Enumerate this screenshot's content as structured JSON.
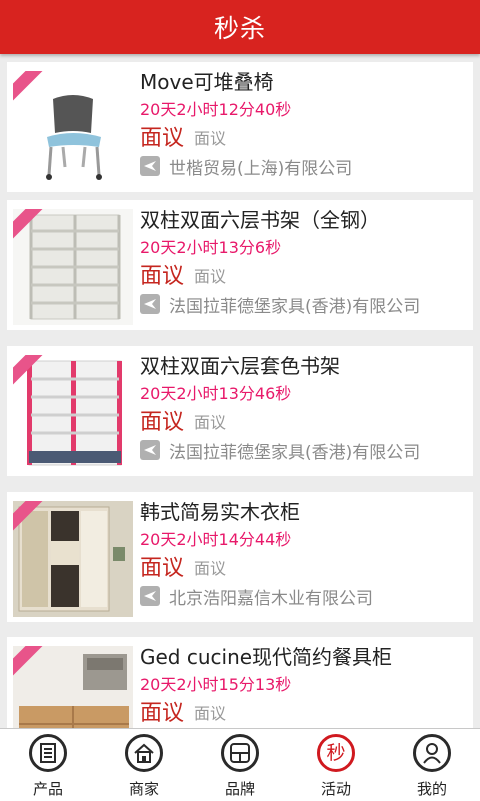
{
  "header": {
    "title": "秒杀"
  },
  "products": [
    {
      "name": "Move可堆叠椅",
      "countdown": "20天2小时12分40秒",
      "price": "面议",
      "price_note": "面议",
      "company": "世楷贸易(上海)有限公司",
      "image": "chair"
    },
    {
      "name": "双柱双面六层书架（全钢）",
      "countdown": "20天2小时13分6秒",
      "price": "面议",
      "price_note": "面议",
      "company": "法国拉菲德堡家具(香港)有限公司",
      "image": "steel-shelf"
    },
    {
      "name": "双柱双面六层套色书架",
      "countdown": "20天2小时13分46秒",
      "price": "面议",
      "price_note": "面议",
      "company": "法国拉菲德堡家具(香港)有限公司",
      "image": "color-shelf"
    },
    {
      "name": "韩式简易实木衣柜",
      "countdown": "20天2小时14分44秒",
      "price": "面议",
      "price_note": "面议",
      "company": "北京浩阳嘉信木业有限公司",
      "image": "wardrobe"
    },
    {
      "name": "Ged cucine现代简约餐具柜",
      "countdown": "20天2小时15分13秒",
      "price": "面议",
      "price_note": "面议",
      "company": "",
      "image": "kitchen"
    }
  ],
  "nav": [
    {
      "label": "产品",
      "icon": "list-icon"
    },
    {
      "label": "商家",
      "icon": "home-icon"
    },
    {
      "label": "品牌",
      "icon": "grid-icon"
    },
    {
      "label": "活动",
      "icon": "miao-icon",
      "glyph": "秒",
      "active": true
    },
    {
      "label": "我的",
      "icon": "person-icon"
    }
  ],
  "colors": {
    "header": "#d8231f",
    "countdown": "#e8196a",
    "price": "#c5261f",
    "active_nav": "#d0191f"
  }
}
